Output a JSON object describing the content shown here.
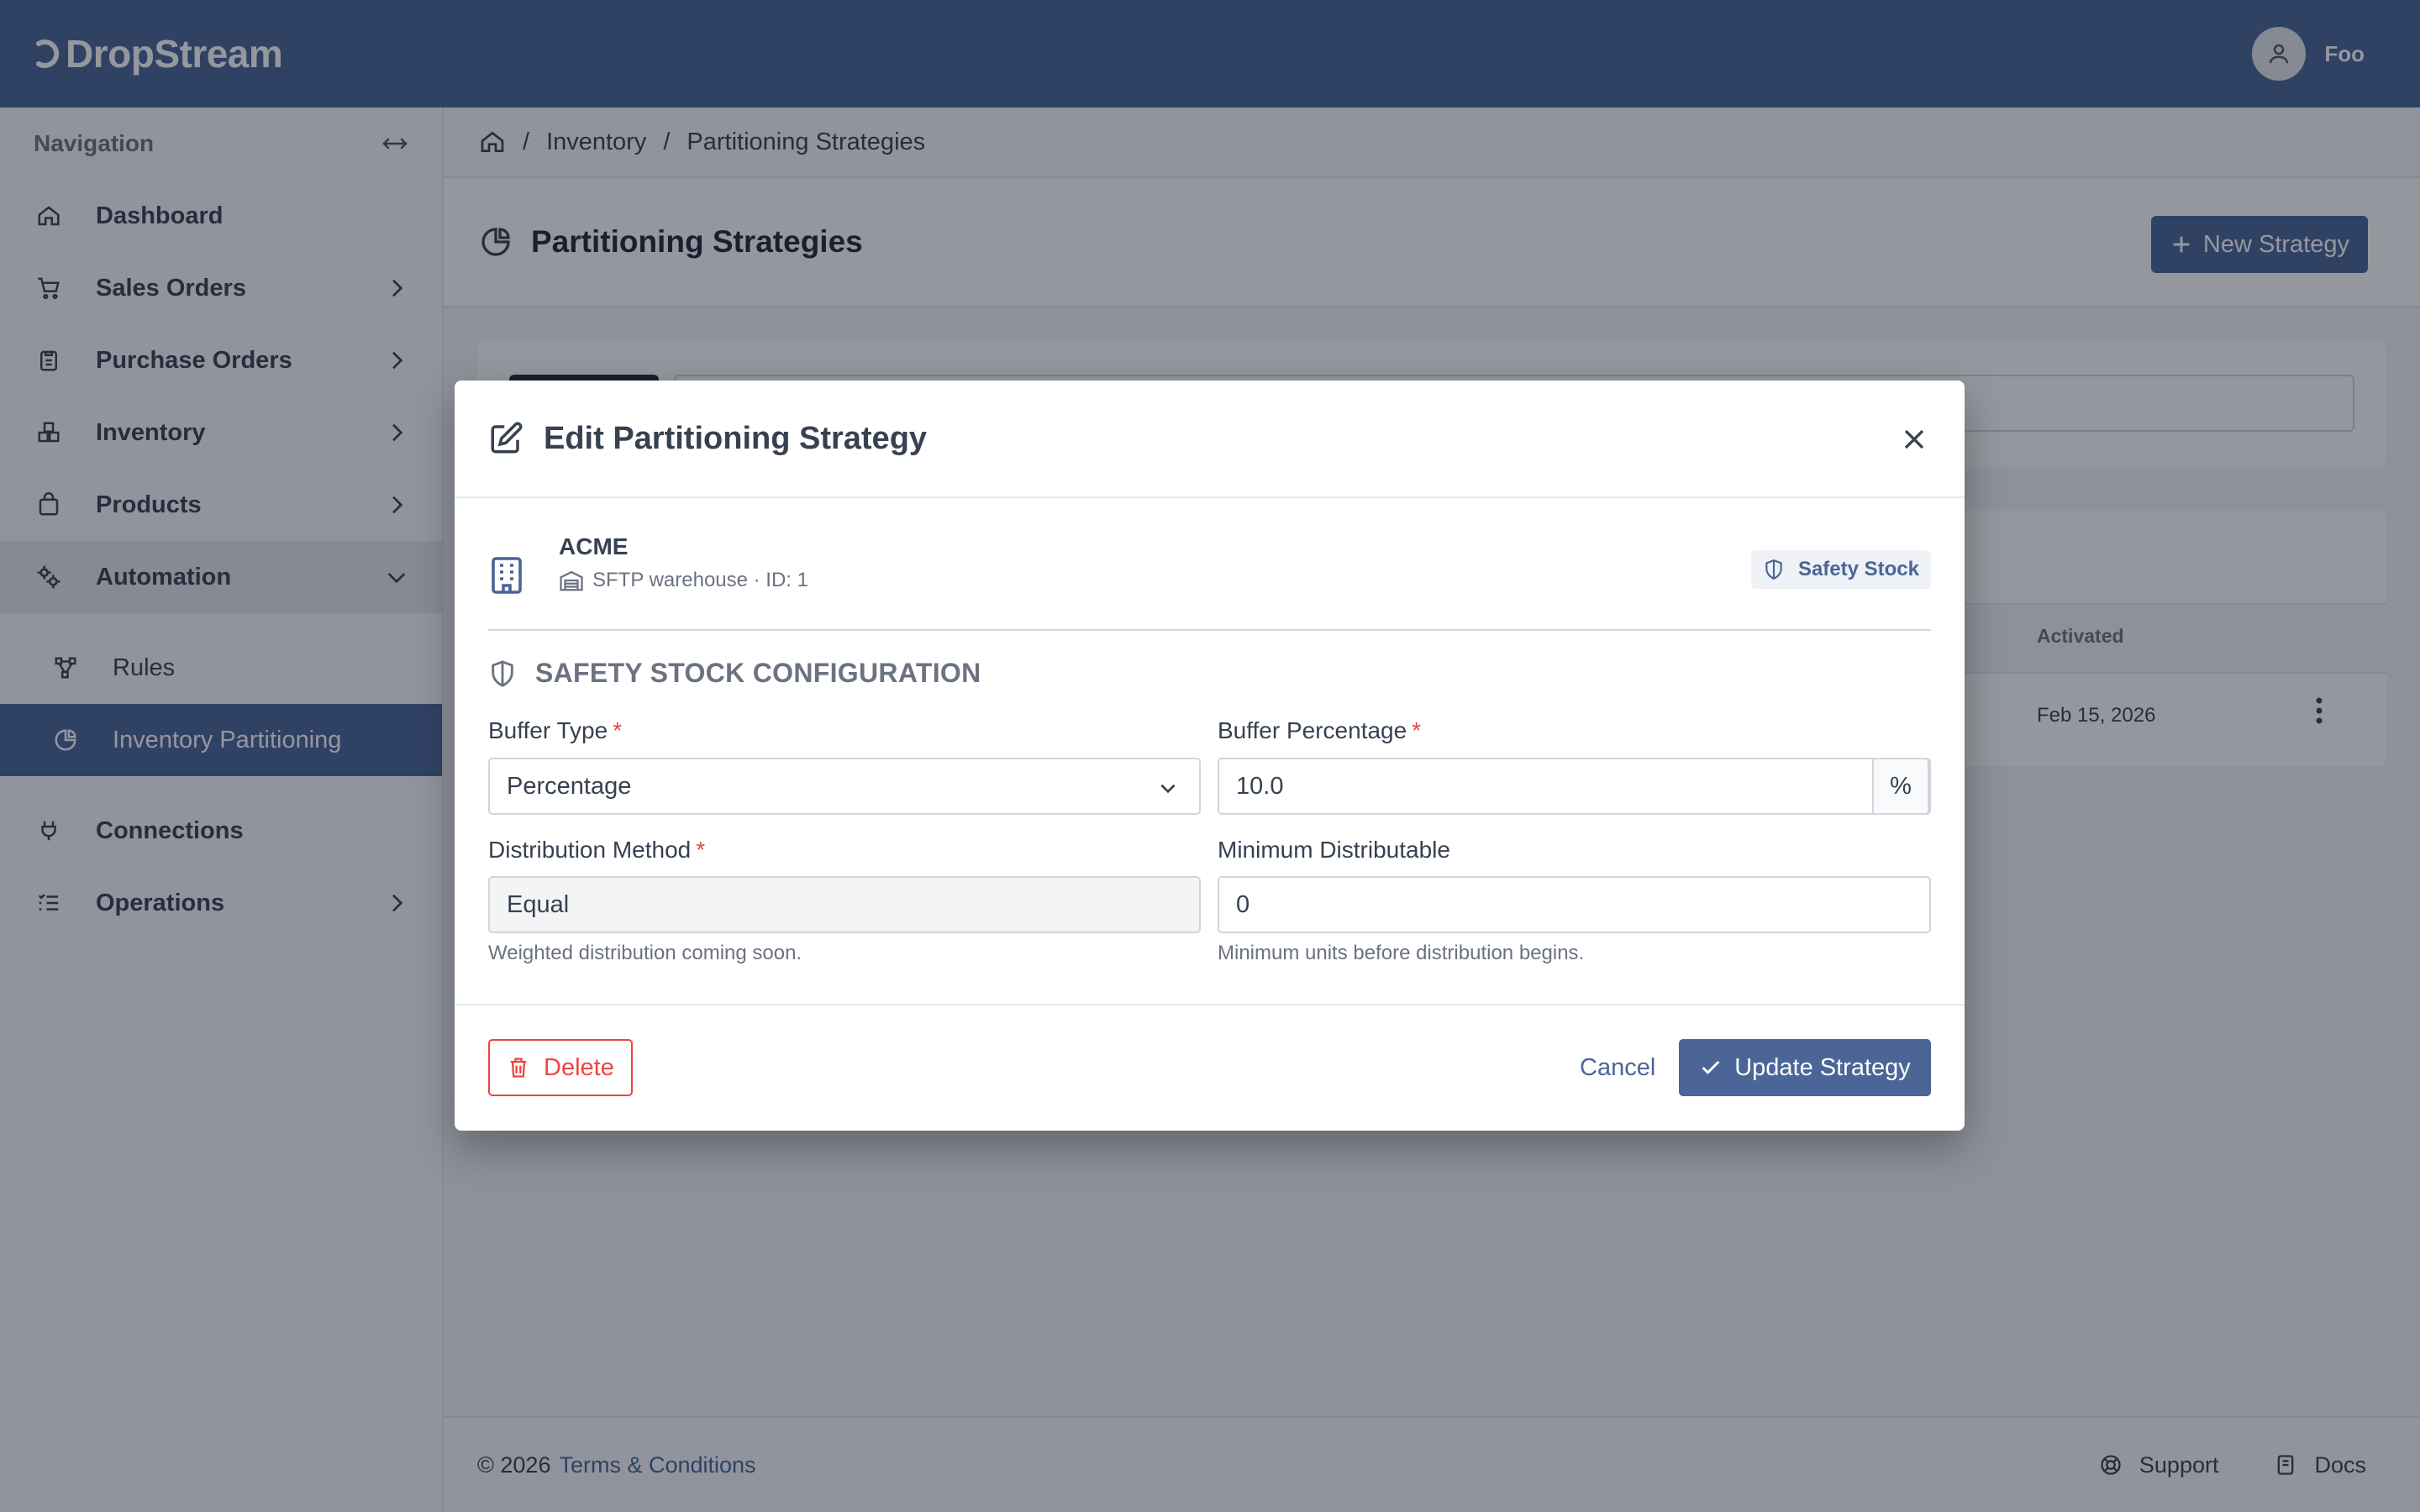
{
  "app": {
    "name": "DropStream"
  },
  "user": {
    "name": "Foo"
  },
  "sidebar": {
    "heading": "Navigation",
    "items": [
      {
        "label": "Dashboard",
        "icon": "home-icon"
      },
      {
        "label": "Sales Orders",
        "icon": "cart-icon"
      },
      {
        "label": "Purchase Orders",
        "icon": "clipboard-icon"
      },
      {
        "label": "Inventory",
        "icon": "boxes-icon"
      },
      {
        "label": "Products",
        "icon": "bag-icon"
      },
      {
        "label": "Automation",
        "icon": "gears-icon"
      },
      {
        "label": "Connections",
        "icon": "plug-icon"
      },
      {
        "label": "Operations",
        "icon": "list-icon"
      }
    ],
    "subitems": [
      {
        "label": "Rules",
        "icon": "flow-icon"
      },
      {
        "label": "Inventory Partitioning",
        "icon": "pie-icon"
      }
    ]
  },
  "breadcrumb": {
    "items": [
      "Inventory",
      "Partitioning Strategies"
    ]
  },
  "page": {
    "title": "Partitioning Strategies",
    "new_button": "New Strategy"
  },
  "table": {
    "col_activated": "Activated",
    "row_date": "Feb 15, 2026"
  },
  "footer": {
    "copyright": "© 2026",
    "terms": "Terms & Conditions",
    "support": "Support",
    "docs": "Docs"
  },
  "modal": {
    "title": "Edit Partitioning Strategy",
    "entity": {
      "name": "ACME",
      "sub": "SFTP warehouse · ID: 1",
      "badge": "Safety Stock"
    },
    "section": "SAFETY STOCK CONFIGURATION",
    "fields": {
      "buffer_type": {
        "label": "Buffer Type",
        "value": "Percentage"
      },
      "buffer_percentage": {
        "label": "Buffer Percentage",
        "value": "10.0",
        "suffix": "%"
      },
      "distribution_method": {
        "label": "Distribution Method",
        "value": "Equal",
        "help": "Weighted distribution coming soon."
      },
      "minimum_distributable": {
        "label": "Minimum Distributable",
        "value": "0",
        "help": "Minimum units before distribution begins."
      }
    },
    "required_mark": "*",
    "buttons": {
      "delete": "Delete",
      "cancel": "Cancel",
      "update": "Update Strategy"
    }
  },
  "colors": {
    "primary": "#4a6596",
    "danger": "#ef4444"
  }
}
